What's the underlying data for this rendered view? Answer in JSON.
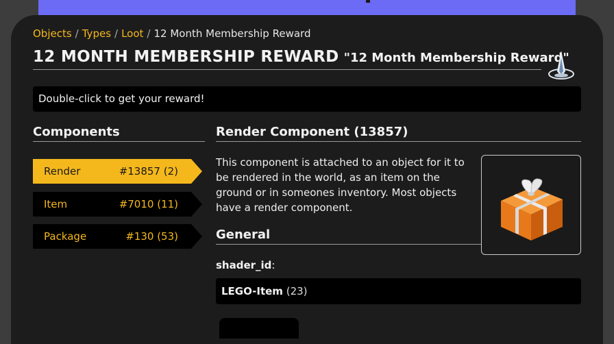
{
  "colors": {
    "accent": "#f5b81c",
    "banner": "#6b6bf5",
    "card": "#1c1c1c",
    "panel": "#000000"
  },
  "breadcrumb": {
    "items": [
      "Objects",
      "Types",
      "Loot"
    ],
    "separator": "/",
    "current": "12 Month Membership Reward"
  },
  "title": {
    "main": "12 MONTH MEMBERSHIP REWARD",
    "sub": "\"12 Month Membership Reward\""
  },
  "description": "Double-click to get your reward!",
  "sidebar": {
    "header": "Components",
    "items": [
      {
        "name": "Render",
        "value": "#13857 (2)",
        "active": true
      },
      {
        "name": "Item",
        "value": "#7010 (11)",
        "active": false
      },
      {
        "name": "Package",
        "value": "#130 (53)",
        "active": false
      }
    ]
  },
  "main": {
    "header": "Render Component (13857)",
    "text": "This component is attached to an object for it to be rendered in the world, as an item on the ground or in someones inventory. Most objects have a render component.",
    "image_icon": "orange-gift-box-icon",
    "general_header": "General",
    "field": {
      "label": "shader_id",
      "colon": ":",
      "value": "LEGO-Item",
      "sub": "(23)"
    }
  },
  "logo_icon": "lego-universe-logo-icon"
}
